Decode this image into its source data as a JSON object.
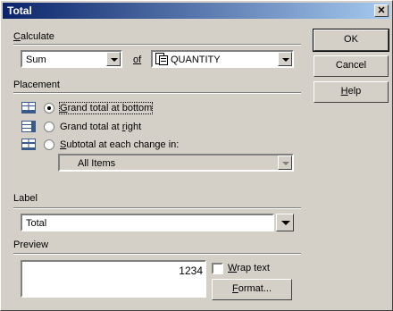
{
  "window": {
    "title": "Total",
    "close_glyph": "✕"
  },
  "calculate": {
    "label_prefix": "C",
    "label_rest": "alculate",
    "function_value": "Sum",
    "of_label": "of",
    "field_value": "QUANTITY",
    "field_icon": "field-icon"
  },
  "placement": {
    "heading": "Placement",
    "options": [
      {
        "pre": "",
        "u": "G",
        "post": "rand total at bottom",
        "selected": true,
        "icon": "grand-total-bottom-icon"
      },
      {
        "pre": "Grand total at ",
        "u": "r",
        "post": "ight",
        "selected": false,
        "icon": "grand-total-right-icon"
      },
      {
        "pre": "",
        "u": "S",
        "post": "ubtotal at each change in:",
        "selected": false,
        "icon": "subtotal-icon"
      }
    ],
    "subtotal_value": "All Items"
  },
  "label_section": {
    "heading": "Label",
    "value": "Total"
  },
  "preview": {
    "heading": "Preview",
    "value": "1234"
  },
  "wrap_text": {
    "pre": "",
    "u": "W",
    "post": "rap text",
    "checked": false
  },
  "buttons": {
    "ok": "OK",
    "cancel": "Cancel",
    "help_u": "H",
    "help_post": "elp",
    "format_u": "F",
    "format_post": "ormat..."
  }
}
